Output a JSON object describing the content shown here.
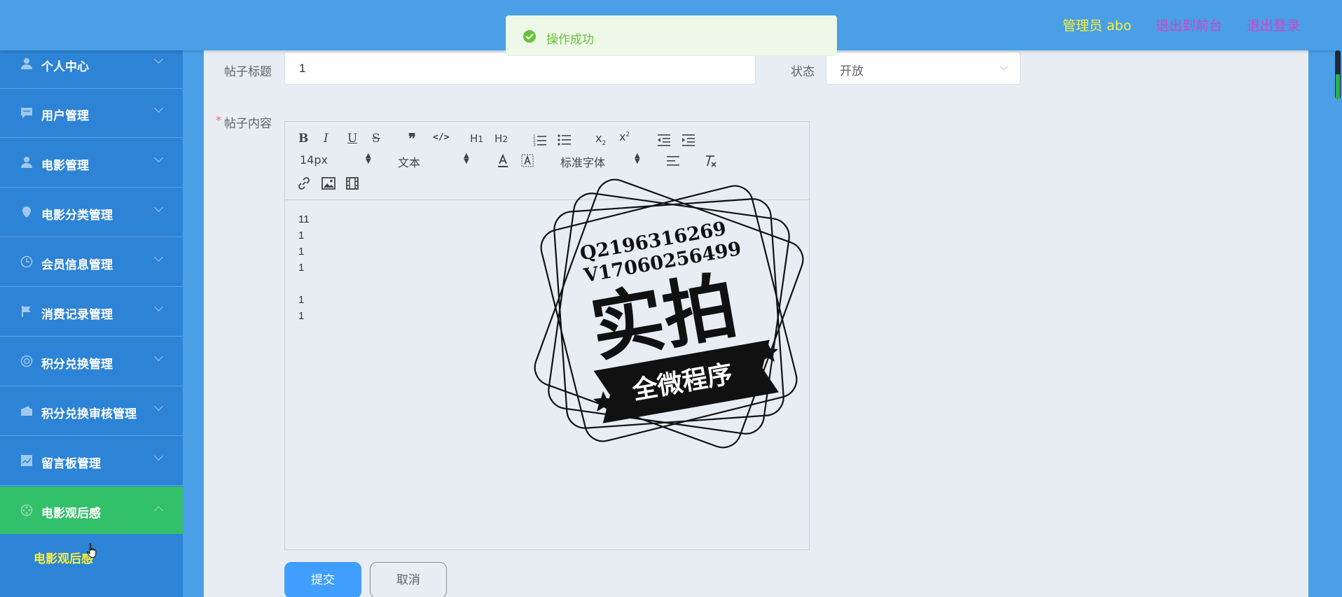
{
  "header": {
    "user": "管理员 abo",
    "to_front": "退出到前台",
    "logout": "退出登录"
  },
  "toast": {
    "message": "操作成功",
    "icon": "success-check-icon"
  },
  "sidebar": {
    "items": [
      {
        "label": "个人中心",
        "icon": "user-icon"
      },
      {
        "label": "用户管理",
        "icon": "chat-icon"
      },
      {
        "label": "电影管理",
        "icon": "user-icon"
      },
      {
        "label": "电影分类管理",
        "icon": "location-icon"
      },
      {
        "label": "会员信息管理",
        "icon": "clock-icon"
      },
      {
        "label": "消费记录管理",
        "icon": "flag-icon"
      },
      {
        "label": "积分兑换管理",
        "icon": "lifebuoy-icon"
      },
      {
        "label": "积分兑换审核管理",
        "icon": "wallet-icon"
      },
      {
        "label": "留言板管理",
        "icon": "chart-icon"
      },
      {
        "label": "电影观后感",
        "icon": "film-icon",
        "active": true
      }
    ],
    "subitem": "电影观后感"
  },
  "form": {
    "title_label": "帖子标题",
    "title_value": "1",
    "status_label": "状态",
    "status_value": "开放",
    "content_label": "帖子内容",
    "required_mark": "*"
  },
  "editor": {
    "font_size": "14px",
    "header_select": "文本",
    "font_family": "标准字体",
    "content_lines": [
      "11",
      "1",
      "1",
      "1",
      "",
      "1",
      "1"
    ]
  },
  "watermark": {
    "line1": "Q2196316269",
    "line2": "V17060256499",
    "big": "实拍",
    "banner": "全微程序"
  },
  "buttons": {
    "submit": "提交",
    "cancel": "取消"
  },
  "colors": {
    "primary": "#409eff",
    "sidebar": "#2d83d6",
    "active": "#33c06a",
    "header": "#4a9fe6",
    "success": "#67c23a"
  }
}
